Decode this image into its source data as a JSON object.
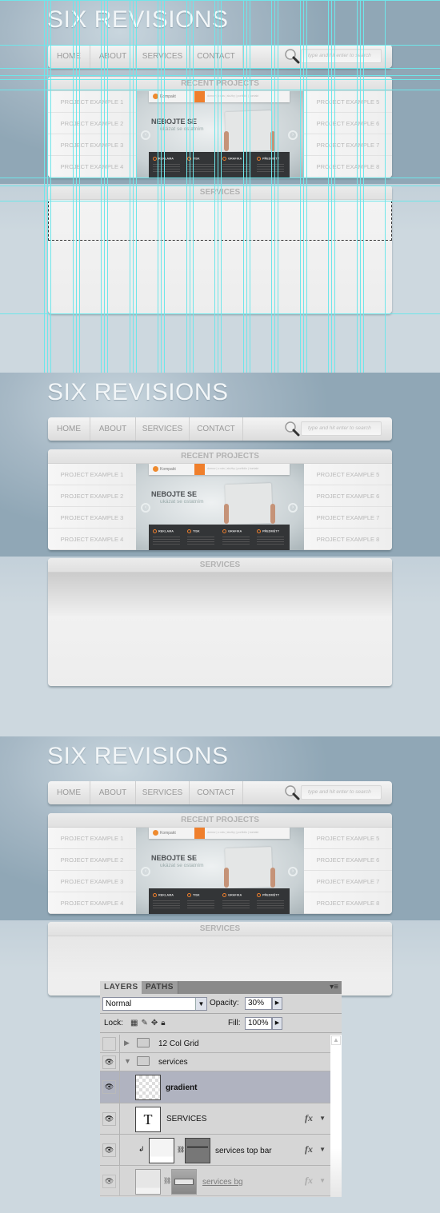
{
  "site": {
    "logo": "SIX REVISIONS",
    "nav": [
      "HOME",
      "ABOUT",
      "SERVICES",
      "CONTACT"
    ],
    "search_placeholder": "type and hit enter to search",
    "recent_projects_title": "RECENT PROJECTS",
    "projects_left": [
      "PROJECT EXAMPLE 1",
      "PROJECT EXAMPLE 2",
      "PROJECT EXAMPLE 3",
      "PROJECT EXAMPLE 4"
    ],
    "projects_right": [
      "PROJECT EXAMPLE 5",
      "PROJECT EXAMPLE 6",
      "PROJECT EXAMPLE 7",
      "PROJECT EXAMPLE 8"
    ],
    "services_title": "SERVICES",
    "slider": {
      "logo": "Kompakt",
      "links": "domov | o nás | služby | portfolio | kontakt",
      "headline": "NEBOJTE SE",
      "subheadline": "ukázat se ostatním",
      "prev": "‹",
      "next": "›",
      "features": [
        "REKLAMA",
        "TISK",
        "GRAFIKA",
        "PŘEDMĚTY"
      ],
      "accent": "#ef7f2c"
    }
  },
  "layers_panel": {
    "tabs": [
      "LAYERS",
      "PATHS"
    ],
    "menu_icon": "≡",
    "blend_mode": "Normal",
    "opacity_label": "Opacity:",
    "opacity_value": "30%",
    "lock_label": "Lock:",
    "fill_label": "Fill:",
    "fill_value": "100%",
    "layers": [
      {
        "name": "12 Col Grid",
        "type": "group",
        "visible": false,
        "expanded": false
      },
      {
        "name": "services",
        "type": "group",
        "visible": true,
        "expanded": true
      },
      {
        "name": "gradient",
        "type": "pixel",
        "visible": true,
        "selected": true
      },
      {
        "name": "SERVICES",
        "type": "text",
        "visible": true,
        "fx": "fx"
      },
      {
        "name": "services top bar",
        "type": "shape",
        "visible": true,
        "fx": "fx",
        "clipped": true
      },
      {
        "name": "services bg",
        "type": "shape",
        "visible": true,
        "fx": "fx"
      }
    ]
  }
}
